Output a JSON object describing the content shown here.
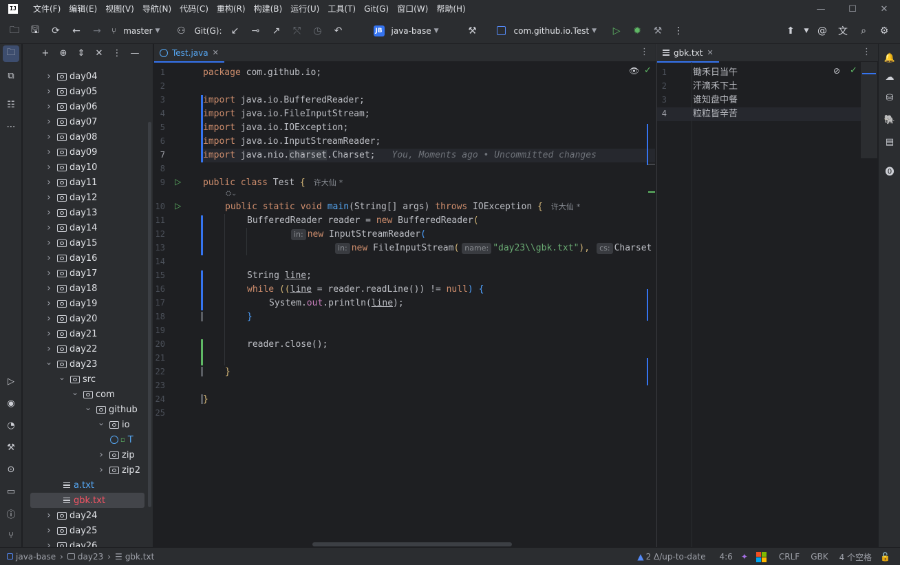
{
  "menu": [
    "文件(F)",
    "编辑(E)",
    "视图(V)",
    "导航(N)",
    "代码(C)",
    "重构(R)",
    "构建(B)",
    "运行(U)",
    "工具(T)",
    "Git(G)",
    "窗口(W)",
    "帮助(H)"
  ],
  "app_logo": "IJ",
  "toolbar": {
    "branch": "master",
    "git_label": "Git(G):",
    "project_badge": "JB",
    "project": "java-base",
    "run_config": "com.github.io.Test"
  },
  "project_tree": [
    {
      "label": "day04",
      "depth": 0,
      "type": "folder",
      "expanded": false
    },
    {
      "label": "day05",
      "depth": 0,
      "type": "folder",
      "expanded": false
    },
    {
      "label": "day06",
      "depth": 0,
      "type": "folder",
      "expanded": false
    },
    {
      "label": "day07",
      "depth": 0,
      "type": "folder",
      "expanded": false
    },
    {
      "label": "day08",
      "depth": 0,
      "type": "folder",
      "expanded": false
    },
    {
      "label": "day09",
      "depth": 0,
      "type": "folder",
      "expanded": false
    },
    {
      "label": "day10",
      "depth": 0,
      "type": "folder",
      "expanded": false
    },
    {
      "label": "day11",
      "depth": 0,
      "type": "folder",
      "expanded": false
    },
    {
      "label": "day12",
      "depth": 0,
      "type": "folder",
      "expanded": false
    },
    {
      "label": "day13",
      "depth": 0,
      "type": "folder",
      "expanded": false
    },
    {
      "label": "day14",
      "depth": 0,
      "type": "folder",
      "expanded": false
    },
    {
      "label": "day15",
      "depth": 0,
      "type": "folder",
      "expanded": false
    },
    {
      "label": "day16",
      "depth": 0,
      "type": "folder",
      "expanded": false
    },
    {
      "label": "day17",
      "depth": 0,
      "type": "folder",
      "expanded": false
    },
    {
      "label": "day18",
      "depth": 0,
      "type": "folder",
      "expanded": false
    },
    {
      "label": "day19",
      "depth": 0,
      "type": "folder",
      "expanded": false
    },
    {
      "label": "day20",
      "depth": 0,
      "type": "folder",
      "expanded": false
    },
    {
      "label": "day21",
      "depth": 0,
      "type": "folder",
      "expanded": false
    },
    {
      "label": "day22",
      "depth": 0,
      "type": "folder",
      "expanded": false
    },
    {
      "label": "day23",
      "depth": 0,
      "type": "folder",
      "expanded": true
    },
    {
      "label": "src",
      "depth": 1,
      "type": "folder",
      "expanded": true
    },
    {
      "label": "com",
      "depth": 2,
      "type": "folder",
      "expanded": true
    },
    {
      "label": "github",
      "depth": 3,
      "type": "folder",
      "expanded": true
    },
    {
      "label": "io",
      "depth": 4,
      "type": "folder",
      "expanded": true
    },
    {
      "label": "T",
      "depth": 5,
      "type": "class",
      "expanded": false
    },
    {
      "label": "zip",
      "depth": 4,
      "type": "folder",
      "expanded": false
    },
    {
      "label": "zip2",
      "depth": 4,
      "type": "folder",
      "expanded": false
    },
    {
      "label": "a.txt",
      "depth": 1,
      "type": "file",
      "color": "blue"
    },
    {
      "label": "gbk.txt",
      "depth": 1,
      "type": "file",
      "color": "red",
      "selected": true
    },
    {
      "label": "day24",
      "depth": 0,
      "type": "folder",
      "expanded": false
    },
    {
      "label": "day25",
      "depth": 0,
      "type": "folder",
      "expanded": false
    },
    {
      "label": "day26",
      "depth": 0,
      "type": "folder",
      "expanded": false
    }
  ],
  "editor_left": {
    "tab": "Test.java",
    "line_numbers": [
      "1",
      "2",
      "3",
      "4",
      "5",
      "6",
      "7",
      "8",
      "9",
      "10",
      "11",
      "12",
      "13",
      "14",
      "15",
      "16",
      "17",
      "18",
      "19",
      "20",
      "21",
      "22",
      "23",
      "24",
      "25"
    ],
    "current_line": "7",
    "blame_hint": "You, Moments ago • Uncommitted changes",
    "author": "许大仙",
    "author_mark": "*",
    "hint_in": "in:",
    "hint_name": "name:",
    "hint_cs": "cs:",
    "code": {
      "l1_kw": "package",
      "l1_rest": " com.github.io;",
      "import_kw": "import",
      "l3": " java.io.BufferedReader;",
      "l4": " java.io.FileInputStream;",
      "l5": " java.io.IOException;",
      "l6": " java.io.InputStreamReader;",
      "l7a": " java.nio.",
      "l7b": "charset",
      "l7c": ".Charset;",
      "l9a": "public class",
      "l9b": " Test ",
      "l9c": "{",
      "l10a": "public static void",
      "l10b": "main",
      "l10c": "(String[] args)",
      "l10d": "throws",
      "l10e": " IOException ",
      "l10f": "{",
      "l11a": "BufferedReader reader = ",
      "l11b": "new",
      "l11c": " BufferedReader",
      "l11d": "(",
      "l12a": "new",
      "l12b": " InputStreamReader",
      "l12c": "(",
      "l13a": "new",
      "l13b": " FileInputStream",
      "l13c": "(",
      "l13d": "\"day23\\\\gbk.txt\"",
      "l13e": "),",
      "l13f": "Charset",
      "l15a": "String ",
      "l15b": "line",
      "l15c": ";",
      "l16a": "while",
      "l16b": " ((",
      "l16c": "line",
      "l16d": " = reader.readLine()) != ",
      "l16e": "null",
      "l16f": ") {",
      "l17a": "System.",
      "l17b": "out",
      "l17c": ".println(",
      "l17d": "line",
      "l17e": ");",
      "l18": "}",
      "l20": "reader.close();",
      "l22": "}",
      "l24": "}"
    }
  },
  "editor_right": {
    "tab": "gbk.txt",
    "lines": [
      {
        "num": "1",
        "text": "锄禾日当午"
      },
      {
        "num": "2",
        "text": "汗滴禾下土"
      },
      {
        "num": "3",
        "text": "谁知盘中餐"
      },
      {
        "num": "4",
        "text": "粒粒皆辛苦"
      }
    ],
    "current_line": "4"
  },
  "statusbar": {
    "crumb1": "java-base",
    "crumb2": "day23",
    "crumb3": "gbk.txt",
    "vcs": "2 Δ/up-to-date",
    "position": "4:6",
    "line_sep": "CRLF",
    "encoding": "GBK",
    "indent": "4 个空格"
  },
  "colors": {
    "accent": "#3574f0",
    "keyword": "#cf8e6d",
    "string": "#6aab73",
    "function": "#56a8f5"
  }
}
